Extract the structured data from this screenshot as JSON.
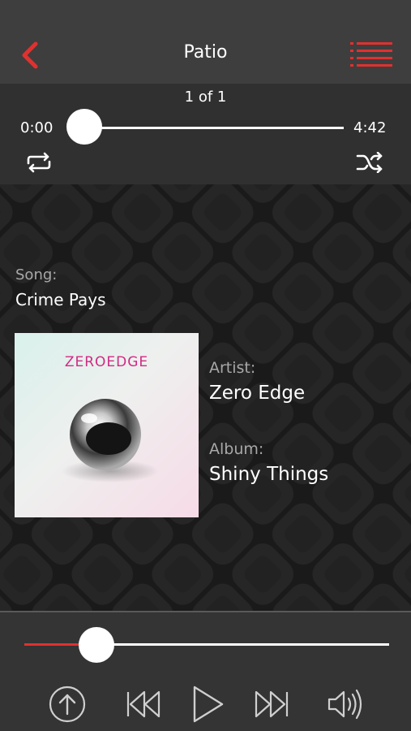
{
  "header": {
    "title": "Patio",
    "back_icon": "chevron-left-icon",
    "menu_icon": "list-menu-icon",
    "accent": "#e0312f"
  },
  "tracker": {
    "count": "1 of 1",
    "elapsed": "0:00",
    "duration": "4:42",
    "progress": 0.0
  },
  "song": {
    "label": "Song:",
    "value": "Crime Pays"
  },
  "artist": {
    "label": "Artist:",
    "value": "Zero Edge"
  },
  "album": {
    "label": "Album:",
    "value": "Shiny Things"
  },
  "album_art": {
    "text": "ZEROEDGE"
  },
  "volume": {
    "level": 0.15
  },
  "controls": {
    "icons": [
      "upload-icon",
      "skip-back-icon",
      "play-icon",
      "skip-forward-icon",
      "volume-icon"
    ]
  }
}
